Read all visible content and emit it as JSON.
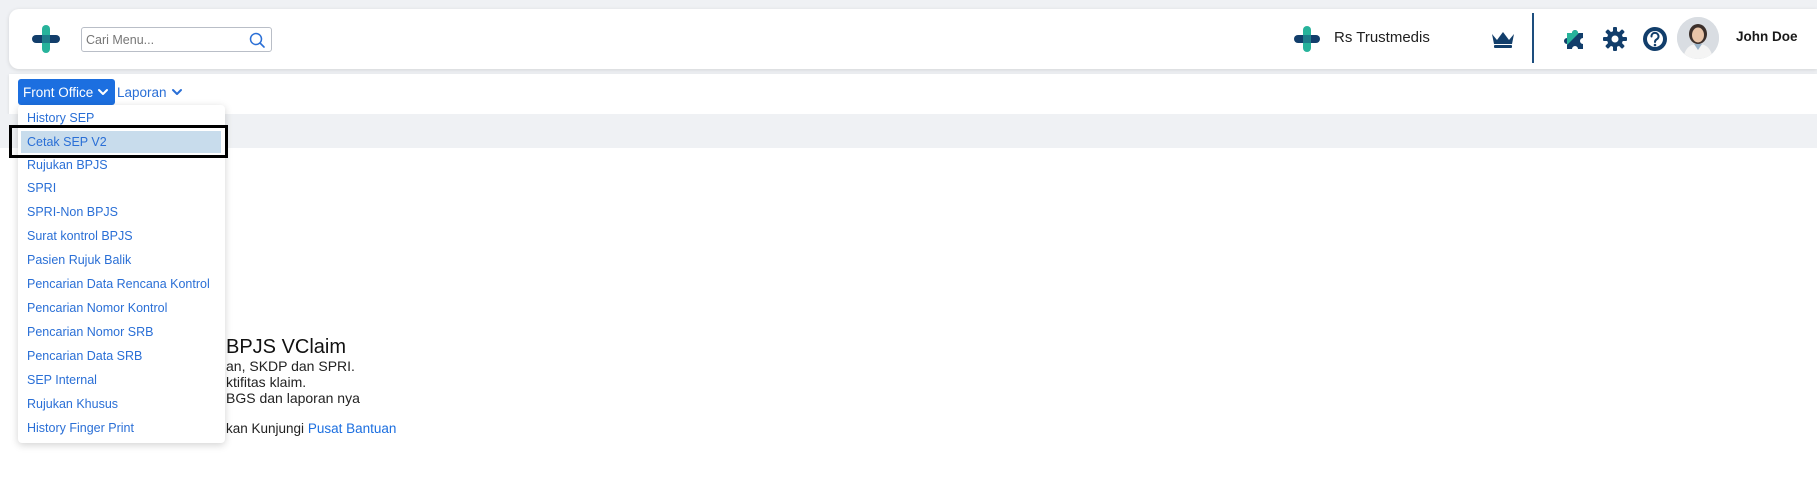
{
  "topbar": {
    "search_placeholder": "Cari Menu...",
    "hospital_name": "Rs Trustmedis",
    "user_name": "John Doe"
  },
  "menubar": {
    "items": [
      {
        "label": "Front Office",
        "active": true
      },
      {
        "label": "Laporan",
        "active": false
      }
    ]
  },
  "dropdown": {
    "highlighted_index": 1,
    "items": [
      "History SEP",
      "Cetak SEP V2",
      "Rujukan BPJS",
      "SPRI",
      "SPRI-Non BPJS",
      "Surat kontrol BPJS",
      "Pasien Rujuk Balik",
      "Pencarian Data Rencana Kontrol",
      "Pencarian Nomor Kontrol",
      "Pencarian Nomor SRB",
      "Pencarian Data SRB",
      "SEP Internal",
      "Rujukan Khusus",
      "History Finger Print"
    ]
  },
  "welcome": {
    "title": "BPJS VClaim",
    "lines": [
      "an, SKDP dan SPRI.",
      "ktifitas klaim.",
      "BGS dan laporan nya"
    ],
    "help_prefix": "kan Kunjungi ",
    "help_link": "Pusat Bantuan"
  },
  "colors": {
    "accent": "#1c6fe0",
    "brand_teal": "#27b39b",
    "brand_navy": "#123e6b",
    "hover_bg": "#c8dcec"
  },
  "icons": [
    "plus-logo-icon",
    "search-icon",
    "crown-icon",
    "puzzle-icon",
    "gear-icon",
    "help-icon",
    "chevron-down-icon"
  ]
}
